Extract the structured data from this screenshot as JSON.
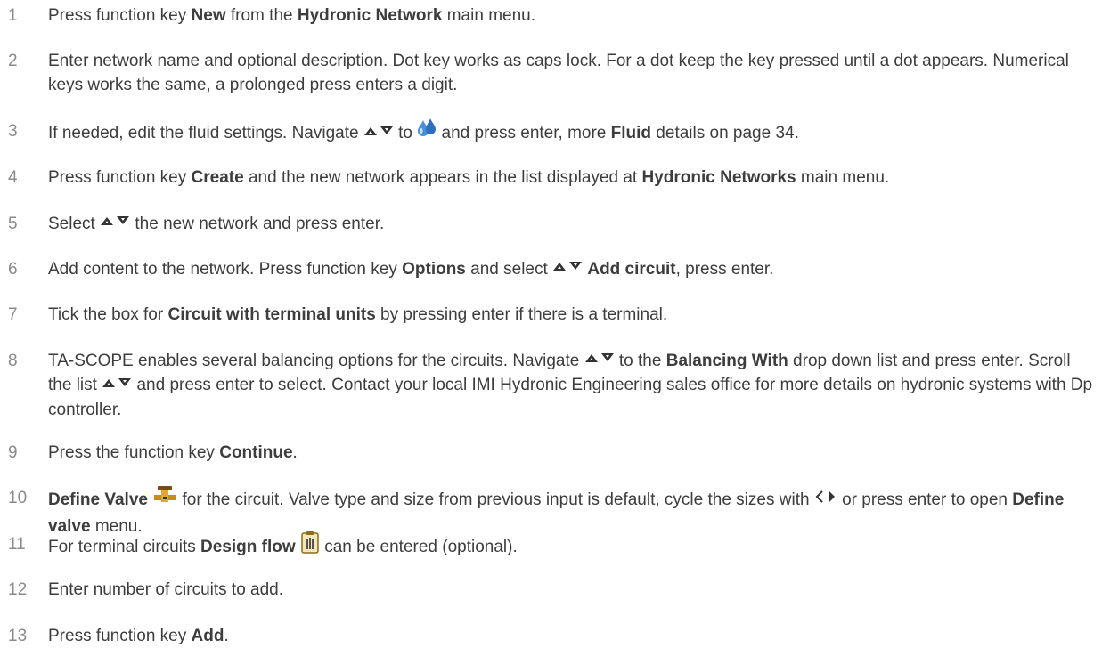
{
  "steps": [
    {
      "num": "1",
      "parts": [
        {
          "t": "Press function key "
        },
        {
          "b": "New"
        },
        {
          "t": " from the "
        },
        {
          "b": "Hydronic Network"
        },
        {
          "t": " main menu."
        }
      ]
    },
    {
      "num": "2",
      "parts": [
        {
          "t": "Enter network name and optional description. Dot key works as caps lock. For a dot keep the key pressed until a dot appears. Numerical keys works the same, a prolonged press enters a digit."
        }
      ]
    },
    {
      "num": "3",
      "parts": [
        {
          "t": "If needed, edit the fluid settings. Navigate "
        },
        {
          "icon": "up-down-arrows-icon"
        },
        {
          "t": " to "
        },
        {
          "icon": "fluid-drops-icon"
        },
        {
          "t": " and press enter, more "
        },
        {
          "b": "Fluid"
        },
        {
          "t": " details on page 34."
        }
      ]
    },
    {
      "num": "4",
      "parts": [
        {
          "t": "Press function key "
        },
        {
          "b": "Create"
        },
        {
          "t": " and the new network appears in the list displayed at "
        },
        {
          "b": "Hydronic Networks"
        },
        {
          "t": " main menu."
        }
      ]
    },
    {
      "num": "5",
      "parts": [
        {
          "t": "Select "
        },
        {
          "icon": "up-down-arrows-icon"
        },
        {
          "t": " the new network and press enter."
        }
      ]
    },
    {
      "num": "6",
      "parts": [
        {
          "t": "Add content to the network. Press function key "
        },
        {
          "b": "Options"
        },
        {
          "t": " and select "
        },
        {
          "icon": "up-down-arrows-icon"
        },
        {
          "t": " "
        },
        {
          "b": "Add circuit"
        },
        {
          "t": ", press enter."
        }
      ]
    },
    {
      "num": "7",
      "parts": [
        {
          "t": "Tick the box for "
        },
        {
          "b": "Circuit with terminal units"
        },
        {
          "t": " by pressing enter if there is a terminal."
        }
      ]
    },
    {
      "num": "8",
      "parts": [
        {
          "t": "TA-SCOPE enables several balancing options for the circuits. Navigate "
        },
        {
          "icon": "up-down-arrows-icon"
        },
        {
          "t": " to the "
        },
        {
          "b": "Balancing With"
        },
        {
          "t": " drop down list and press enter. Scroll the list "
        },
        {
          "icon": "up-down-arrows-icon"
        },
        {
          "t": " and press enter to select. Contact your local IMI Hydronic Engineering sales office for more details on hydronic systems with Dp controller."
        }
      ]
    },
    {
      "num": "9",
      "parts": [
        {
          "t": "Press the function key "
        },
        {
          "b": "Continue"
        },
        {
          "t": "."
        }
      ]
    },
    {
      "num": "10",
      "parts": [
        {
          "b": "Define Valve"
        },
        {
          "t": " "
        },
        {
          "icon": "valve-icon"
        },
        {
          "t": " for the circuit. Valve type and size from previous input is default, cycle the sizes with "
        },
        {
          "icon": "left-right-arrows-icon"
        },
        {
          "t": " or press enter to open "
        },
        {
          "b": "Define valve"
        },
        {
          "t": " menu."
        }
      ]
    },
    {
      "num": "11",
      "parts": [
        {
          "t": "For terminal circuits "
        },
        {
          "b": "Design flow"
        },
        {
          "t": " "
        },
        {
          "icon": "design-flow-icon"
        },
        {
          "t": " can be entered (optional)."
        }
      ]
    },
    {
      "num": "12",
      "parts": [
        {
          "t": "Enter number of circuits to add."
        }
      ]
    },
    {
      "num": "13",
      "parts": [
        {
          "t": "Press function key "
        },
        {
          "b": "Add"
        },
        {
          "t": "."
        }
      ]
    }
  ]
}
